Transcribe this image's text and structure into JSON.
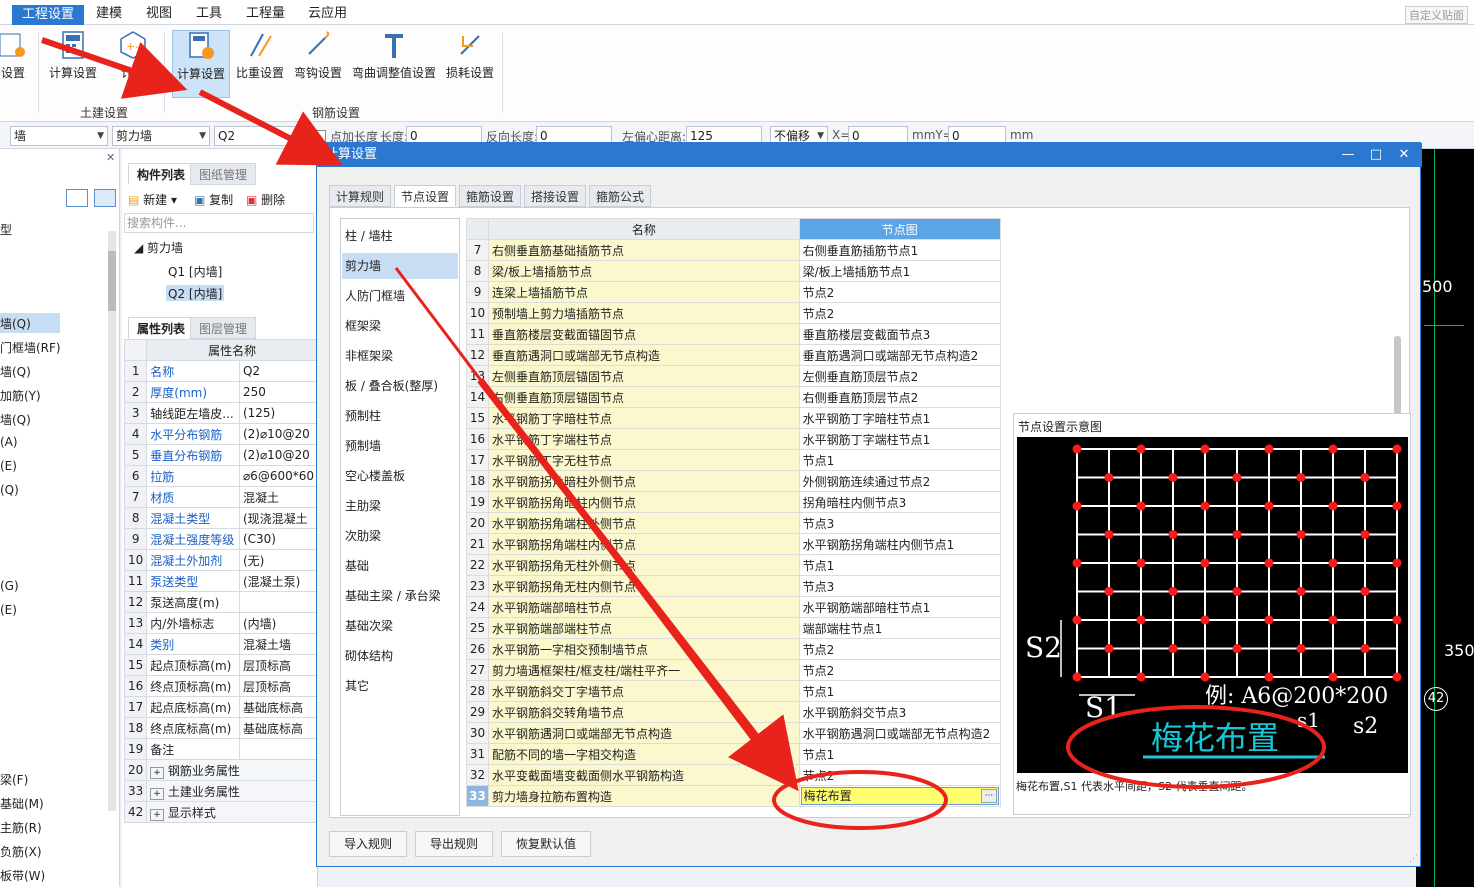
{
  "menubar": {
    "items": [
      "工程设置",
      "建模",
      "视图",
      "工具",
      "工程量",
      "云应用"
    ],
    "custom_label": "自定义贴面"
  },
  "ribbon": {
    "btn_partial_left": "设置",
    "btn_calc1": "计算设置",
    "btn_partial2": "计算",
    "btn_calc_sel": "计算设置",
    "btn_ratio": "比重设置",
    "btn_hook": "弯钩设置",
    "btn_bend": "弯曲调整值设置",
    "btn_loss": "损耗设置",
    "group_civil": "土建设置",
    "group_rebar": "钢筋设置"
  },
  "toolbar": {
    "sel1": "墙",
    "sel2": "剪力墙",
    "sel3": "Q2",
    "chk_label": "点加长度",
    "len_label": "长度:",
    "len_val": "0",
    "rev_label": "反向长度:",
    "rev_val": "0",
    "left_label": "左偏心距离:",
    "left_val": "125",
    "offset_sel": "不偏移",
    "x_label": "X=",
    "x_val": "0",
    "mm_label": "mmY=",
    "y_val": "0",
    "mm2": "mm"
  },
  "leftnav": {
    "items": [
      "型",
      "墙(Q)",
      "门框墙(RF)",
      "墙(Q)",
      "加筋(Y)",
      "墙(Q)",
      "(A)",
      "(E)",
      "(Q)",
      "(G)",
      "(E)",
      "梁(F)",
      "基础(M)",
      "主筋(R)",
      "负筋(X)",
      "板带(W)"
    ]
  },
  "comp": {
    "tab1": "构件列表",
    "tab2": "图纸管理",
    "new": "新建",
    "copy": "复制",
    "del": "删除",
    "search_ph": "搜索构件...",
    "tree_root": "剪力墙",
    "tree_q1": "Q1 [内墙]",
    "tree_q2": "Q2 [内墙]"
  },
  "props": {
    "tab1": "属性列表",
    "tab2": "图层管理",
    "hdr": "属性名称",
    "rows": [
      [
        "1",
        "名称",
        "Q2"
      ],
      [
        "2",
        "厚度(mm)",
        "250"
      ],
      [
        "3",
        "轴线距左墙皮...",
        "(125)"
      ],
      [
        "4",
        "水平分布钢筋",
        "(2)⌀10@20"
      ],
      [
        "5",
        "垂直分布钢筋",
        "(2)⌀10@20"
      ],
      [
        "6",
        "拉筋",
        "⌀6@600*60"
      ],
      [
        "7",
        "材质",
        "混凝土"
      ],
      [
        "8",
        "混凝土类型",
        "(现浇混凝土"
      ],
      [
        "9",
        "混凝土强度等级",
        "(C30)"
      ],
      [
        "10",
        "混凝土外加剂",
        "(无)"
      ],
      [
        "11",
        "泵送类型",
        "(混凝土泵)"
      ],
      [
        "12",
        "泵送高度(m)",
        ""
      ],
      [
        "13",
        "内/外墙标志",
        "(内墙)"
      ],
      [
        "14",
        "类别",
        "混凝土墙"
      ],
      [
        "15",
        "起点顶标高(m)",
        "层顶标高"
      ],
      [
        "16",
        "终点顶标高(m)",
        "层顶标高"
      ],
      [
        "17",
        "起点底标高(m)",
        "基础底标高"
      ],
      [
        "18",
        "终点底标高(m)",
        "基础底标高"
      ],
      [
        "19",
        "备注",
        ""
      ],
      [
        "20",
        "钢筋业务属性",
        ""
      ],
      [
        "33",
        "土建业务属性",
        ""
      ],
      [
        "42",
        "显示样式",
        ""
      ]
    ]
  },
  "cad": {
    "t1": "500",
    "t2": "350",
    "t3": "42"
  },
  "dialog": {
    "title": "计算设置",
    "tabs": [
      "计算规则",
      "节点设置",
      "箍筋设置",
      "搭接设置",
      "箍筋公式"
    ],
    "cats": [
      "柱 / 墙柱",
      "剪力墙",
      "人防门框墙",
      "框架梁",
      "非框架梁",
      "板 / 叠合板(整厚)",
      "预制柱",
      "预制墙",
      "空心楼盖板",
      "主肋梁",
      "次肋梁",
      "基础",
      "基础主梁 / 承台梁",
      "基础次梁",
      "砌体结构",
      "其它"
    ],
    "col_name": "名称",
    "col_node": "节点图",
    "rows": [
      [
        "7",
        "右侧垂直筋基础插筋节点",
        "右侧垂直筋插筋节点1"
      ],
      [
        "8",
        "梁/板上墙插筋节点",
        "梁/板上墙插筋节点1"
      ],
      [
        "9",
        "连梁上墙插筋节点",
        "节点2"
      ],
      [
        "10",
        "预制墙上剪力墙插筋节点",
        "节点2"
      ],
      [
        "11",
        "垂直筋楼层变截面锚固节点",
        "垂直筋楼层变截面节点3"
      ],
      [
        "12",
        "垂直筋遇洞口或端部无节点构造",
        "垂直筋遇洞口或端部无节点构造2"
      ],
      [
        "13",
        "左侧垂直筋顶层锚固节点",
        "左侧垂直筋顶层节点2"
      ],
      [
        "14",
        "右侧垂直筋顶层锚固节点",
        "右侧垂直筋顶层节点2"
      ],
      [
        "15",
        "水平钢筋丁字暗柱节点",
        "水平钢筋丁字暗柱节点1"
      ],
      [
        "16",
        "水平钢筋丁字端柱节点",
        "水平钢筋丁字端柱节点1"
      ],
      [
        "17",
        "水平钢筋丁字无柱节点",
        "节点1"
      ],
      [
        "18",
        "水平钢筋拐角暗柱外侧节点",
        "外侧钢筋连续通过节点2"
      ],
      [
        "19",
        "水平钢筋拐角暗柱内侧节点",
        "拐角暗柱内侧节点3"
      ],
      [
        "20",
        "水平钢筋拐角端柱外侧节点",
        "节点3"
      ],
      [
        "21",
        "水平钢筋拐角端柱内侧节点",
        "水平钢筋拐角端柱内侧节点1"
      ],
      [
        "22",
        "水平钢筋拐角无柱外侧节点",
        "节点1"
      ],
      [
        "23",
        "水平钢筋拐角无柱内侧节点",
        "节点3"
      ],
      [
        "24",
        "水平钢筋端部暗柱节点",
        "水平钢筋端部暗柱节点1"
      ],
      [
        "25",
        "水平钢筋端部端柱节点",
        "端部端柱节点1"
      ],
      [
        "26",
        "水平钢筋一字相交预制墙节点",
        "节点2"
      ],
      [
        "27",
        "剪力墙遇框架柱/框支柱/端柱平齐一",
        "节点2"
      ],
      [
        "28",
        "水平钢筋斜交丁字墙节点",
        "节点1"
      ],
      [
        "29",
        "水平钢筋斜交转角墙节点",
        "水平钢筋斜交节点3"
      ],
      [
        "30",
        "水平钢筋遇洞口或端部无节点构造",
        "水平钢筋遇洞口或端部无节点构造2"
      ],
      [
        "31",
        "配筋不同的墙一字相交构造",
        "节点1"
      ],
      [
        "32",
        "水平变截面墙变截面侧水平钢筋构造",
        "节点2"
      ],
      [
        "33",
        "剪力墙身拉筋布置构造",
        "梅花布置"
      ]
    ],
    "diag_title": "节点设置示意图",
    "diag_s1": "S1",
    "diag_s2": "S2",
    "diag_example": "例: A6@200*200",
    "diag_s1b": "s1",
    "diag_s2b": "s2",
    "diag_label": "梅花布置",
    "diag_caption": "梅花布置,S1 代表水平间距，S2 代表垂直间距。",
    "btn_import": "导入规则",
    "btn_export": "导出规则",
    "btn_reset": "恢复默认值"
  },
  "colors": {
    "accent": "#2b78d0",
    "annot": "#e8231b",
    "cyan": "#19c6d6",
    "node": "#ff1a1a"
  }
}
